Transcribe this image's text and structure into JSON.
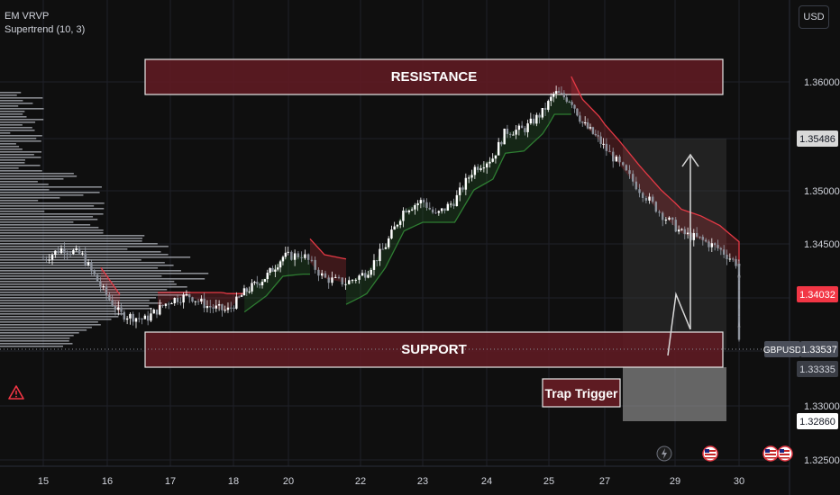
{
  "header": {
    "indicators": [
      "EM VRVP",
      "Supertrend (10, 3)"
    ],
    "currency": "USD"
  },
  "colors": {
    "background": "#0f0f0f",
    "zone_fill": "#5e1b22",
    "zone_border": "#e8e8e8",
    "supertrend_up": "#2e7d32",
    "supertrend_down": "#e53945",
    "candle": "#ffffff",
    "price_tag": "#f23645",
    "volume_profile": "#b2b5be"
  },
  "annotations": {
    "resistance_label": "RESISTANCE",
    "support_label": "SUPPORT",
    "trap_label": "Trap Trigger"
  },
  "price_axis": {
    "ticks": [
      "1.36000",
      "1.35000",
      "1.34500",
      "1.33000",
      "1.32500"
    ],
    "tags": {
      "target": "1.35486",
      "supertrend": "1.34032",
      "symbol": "GBPUSD",
      "last": "1.33537",
      "support_low": "1.33335",
      "stop": "1.32860"
    }
  },
  "time_axis": {
    "labels": [
      "15",
      "16",
      "17",
      "18",
      "20",
      "22",
      "23",
      "24",
      "25",
      "27",
      "29",
      "30"
    ]
  },
  "chart_data": {
    "type": "candlestick",
    "symbol": "GBPUSD",
    "x_categories": [
      "15",
      "16",
      "17",
      "18",
      "20",
      "22",
      "23",
      "24",
      "25",
      "27",
      "29",
      "30"
    ],
    "ylim": [
      1.323,
      1.364
    ],
    "y_ticks": [
      1.36,
      1.35,
      1.345,
      1.33,
      1.325
    ],
    "resistance_zone": [
      1.3586,
      1.3616
    ],
    "support_zone": [
      1.3319,
      1.3349
    ],
    "projection": {
      "entry": 1.33537,
      "target": 1.35486,
      "stop": 1.3286
    },
    "last_price": 1.33537,
    "supertrend_value": 1.34032,
    "price_path": [
      [
        0,
        1.3436
      ],
      [
        0.3,
        1.3446
      ],
      [
        0.6,
        1.344
      ],
      [
        0.9,
        1.341
      ],
      [
        1.2,
        1.3385
      ],
      [
        1.6,
        1.338
      ],
      [
        2.0,
        1.3398
      ],
      [
        2.3,
        1.3402
      ],
      [
        2.6,
        1.3392
      ],
      [
        2.9,
        1.3388
      ],
      [
        3.2,
        1.3405
      ],
      [
        3.6,
        1.342
      ],
      [
        3.9,
        1.3438
      ],
      [
        4.2,
        1.344
      ],
      [
        4.5,
        1.3418
      ],
      [
        4.8,
        1.3414
      ],
      [
        5.1,
        1.3424
      ],
      [
        5.4,
        1.3448
      ],
      [
        5.7,
        1.3482
      ],
      [
        6.0,
        1.349
      ],
      [
        6.2,
        1.3476
      ],
      [
        6.5,
        1.349
      ],
      [
        6.8,
        1.352
      ],
      [
        7.1,
        1.353
      ],
      [
        7.3,
        1.3554
      ],
      [
        7.6,
        1.3556
      ],
      [
        7.9,
        1.3572
      ],
      [
        8.1,
        1.359
      ],
      [
        8.4,
        1.3583
      ],
      [
        8.6,
        1.3562
      ],
      [
        8.9,
        1.3546
      ],
      [
        9.2,
        1.3524
      ],
      [
        9.5,
        1.35
      ],
      [
        9.8,
        1.3478
      ],
      [
        10.1,
        1.346
      ],
      [
        10.4,
        1.3454
      ],
      [
        10.7,
        1.3445
      ],
      [
        11.0,
        1.343
      ],
      [
        11.3,
        1.3415
      ],
      [
        11.5,
        1.3388
      ],
      [
        11.7,
        1.3354
      ]
    ]
  }
}
